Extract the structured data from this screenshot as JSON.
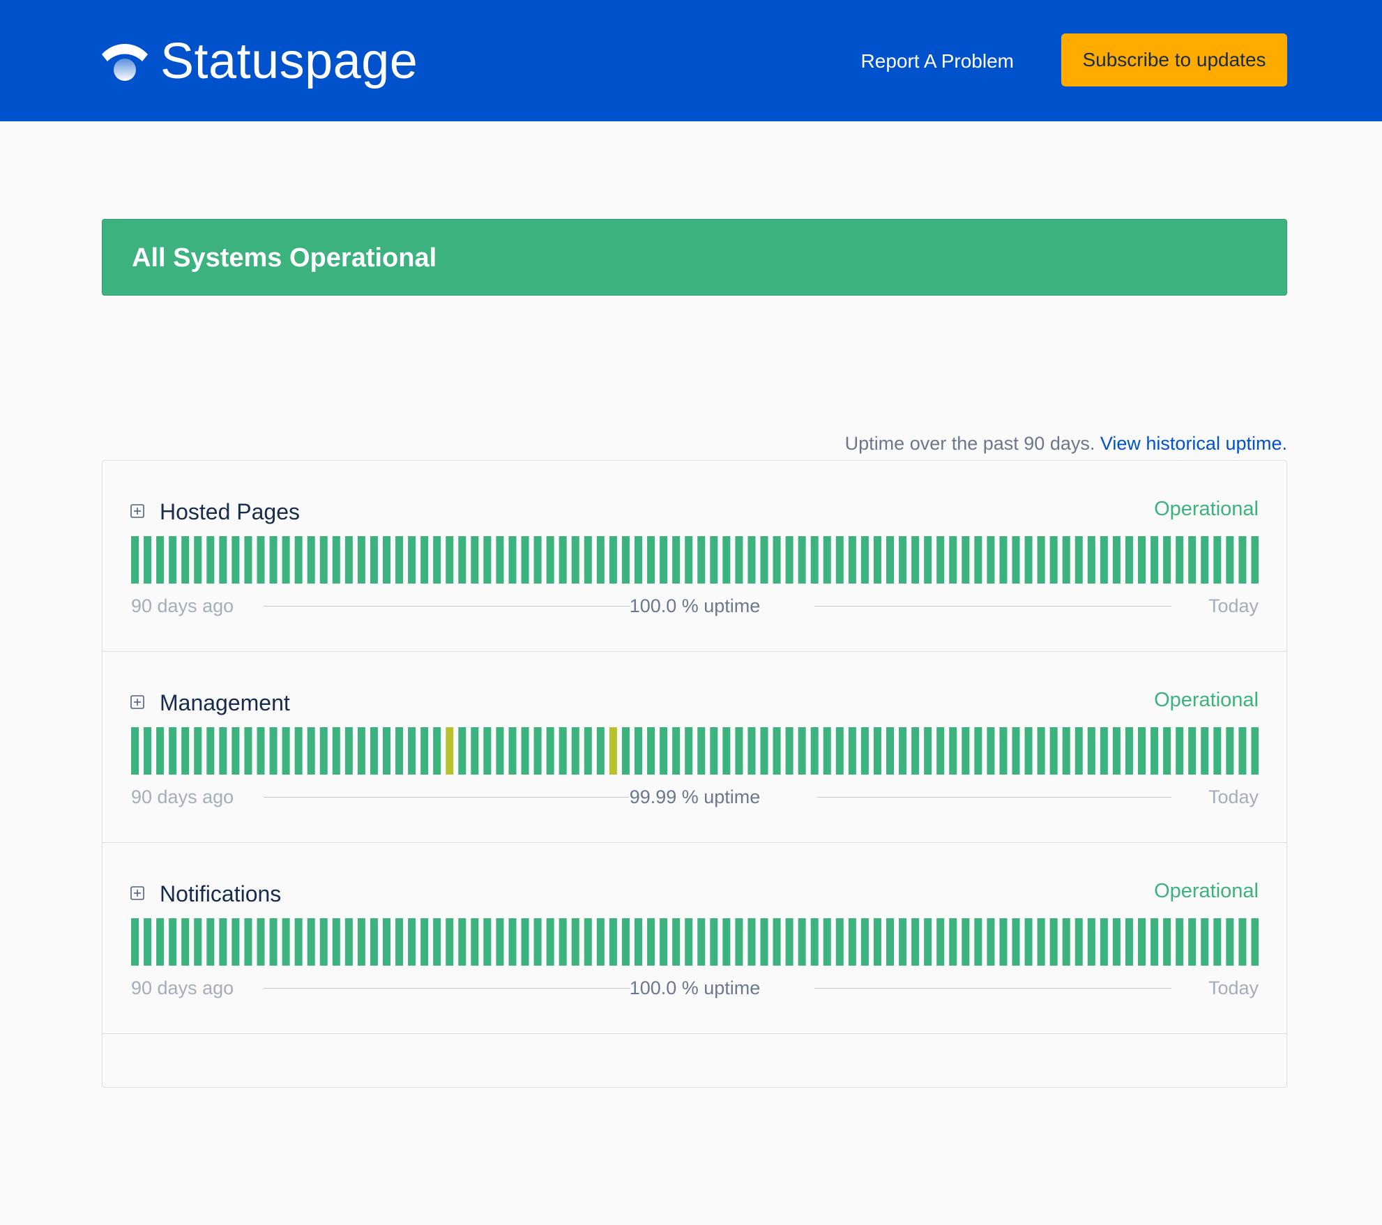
{
  "header": {
    "logo_text": "Statuspage",
    "logo_icon": "statuspage-logo-icon",
    "report_label": "Report A Problem",
    "subscribe_label": "Subscribe to updates"
  },
  "banner": {
    "text": "All Systems Operational"
  },
  "uptime_note": {
    "text": "Uptime over the past 90 days.",
    "link_label": "View historical uptime."
  },
  "colors": {
    "header_bg": "#0052cc",
    "operational": "#3cb27f",
    "minor": "#b9c12e",
    "subscribe_bg": "#ffab00"
  },
  "components": [
    {
      "name": "Hosted Pages",
      "status": "Operational",
      "left_label": "90 days ago",
      "uptime_label": "100.0 % uptime",
      "right_label": "Today",
      "days": 90,
      "minor_days": []
    },
    {
      "name": "Management",
      "status": "Operational",
      "left_label": "90 days ago",
      "uptime_label": "99.99 % uptime",
      "right_label": "Today",
      "days": 90,
      "minor_days": [
        25,
        38
      ]
    },
    {
      "name": "Notifications",
      "status": "Operational",
      "left_label": "90 days ago",
      "uptime_label": "100.0 % uptime",
      "right_label": "Today",
      "days": 90,
      "minor_days": []
    }
  ]
}
